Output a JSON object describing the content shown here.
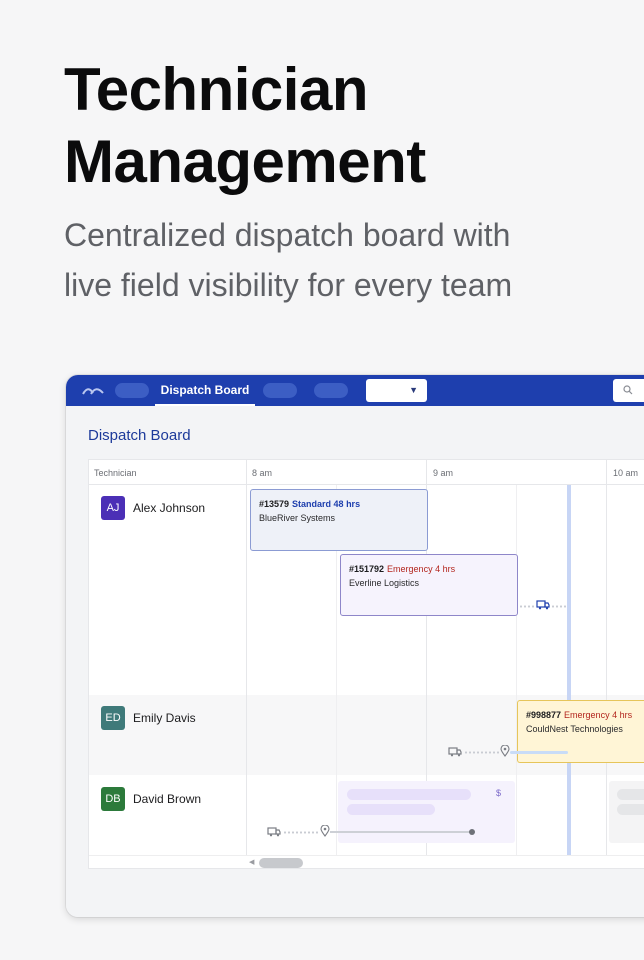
{
  "hero": {
    "title_line1": "Technician",
    "title_line2": "Management",
    "subtitle_line1": "Centralized dispatch board with",
    "subtitle_line2": "live field visibility for every team"
  },
  "topbar": {
    "active_tab": "Dispatch Board",
    "color": "#1e3fae"
  },
  "page": {
    "title": "Dispatch Board"
  },
  "board": {
    "column_technician": "Technician",
    "time_columns": [
      "8 am",
      "9 am",
      "10 am"
    ],
    "technicians": [
      {
        "initials": "AJ",
        "name": "Alex Johnson",
        "color": "#4b2fb6"
      },
      {
        "initials": "ED",
        "name": "Emily Davis",
        "color": "#3f7a7a"
      },
      {
        "initials": "DB",
        "name": "David Brown",
        "color": "#2c7a3b"
      }
    ],
    "jobs": [
      {
        "id": "#13579",
        "priority": "Standard 48 hrs",
        "priority_color": "#1e3fae",
        "client": "BlueRiver Systems"
      },
      {
        "id": "#151792",
        "priority": "Emergency 4 hrs",
        "priority_color": "#b3261e",
        "client": "Everline Logistics"
      },
      {
        "id": "#998877",
        "priority": "Emergency 4 hrs",
        "priority_color": "#b3261e",
        "client": "CouldNest Technologies"
      }
    ],
    "placeholder_symbol": "$"
  }
}
